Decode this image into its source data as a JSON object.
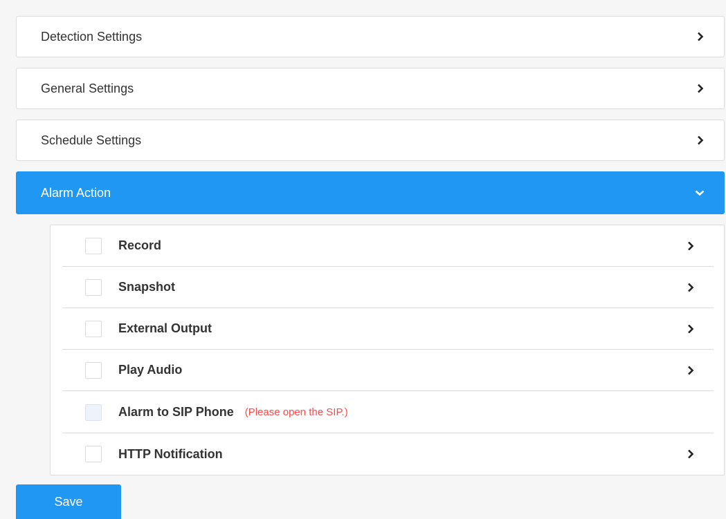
{
  "sections": [
    {
      "label": "Detection Settings",
      "expanded": false
    },
    {
      "label": "General Settings",
      "expanded": false
    },
    {
      "label": "Schedule Settings",
      "expanded": false
    },
    {
      "label": "Alarm Action",
      "expanded": true
    }
  ],
  "alarm_actions": [
    {
      "label": "Record",
      "checked": false,
      "has_details": true
    },
    {
      "label": "Snapshot",
      "checked": false,
      "has_details": true
    },
    {
      "label": "External Output",
      "checked": false,
      "has_details": true
    },
    {
      "label": "Play Audio",
      "checked": false,
      "has_details": true
    },
    {
      "label": "Alarm to SIP Phone",
      "note": "(Please open the SIP.)",
      "checked": false,
      "disabled": true,
      "has_details": false
    },
    {
      "label": "HTTP Notification",
      "checked": false,
      "has_details": true
    }
  ],
  "save_label": "Save",
  "colors": {
    "accent": "#1f97f3",
    "warning_text": "#ff4949",
    "background": "#f6f6f6",
    "border": "#dcdcdc"
  },
  "icons": {
    "collapsed": "chevron-right-icon",
    "expanded": "chevron-down-icon"
  }
}
